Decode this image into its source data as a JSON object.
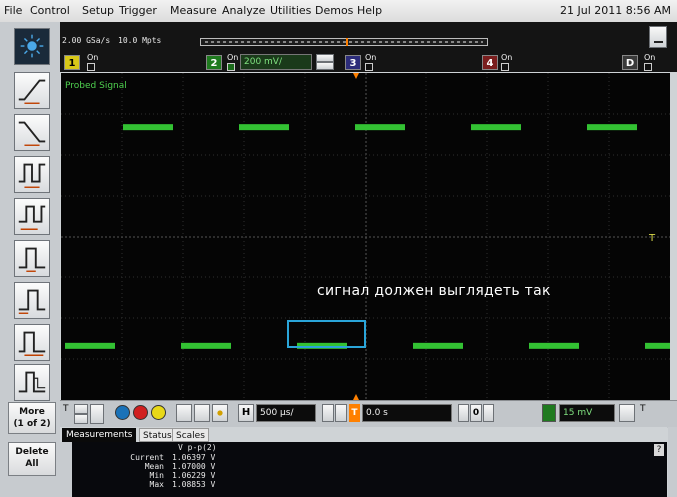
{
  "menu": {
    "items": [
      "File",
      "Control",
      "Setup",
      "Trigger",
      "Measure",
      "Analyze",
      "Utilities",
      "Demos",
      "Help"
    ],
    "datetime": "21 Jul 2011  8:56 AM"
  },
  "acquisition": {
    "sample_rate": "2.00 GSa/s",
    "memory_depth": "10.0 Mpts"
  },
  "channels": {
    "ch1": {
      "number": "1",
      "state": "On",
      "color": "#f2e21c"
    },
    "ch2": {
      "number": "2",
      "state": "On",
      "scale": "200 mV/",
      "color": "#34c132"
    },
    "ch3": {
      "number": "3",
      "state": "On",
      "color": "#6a6ad8"
    },
    "ch4": {
      "number": "4",
      "state": "On",
      "color": "#e04848"
    },
    "digital": {
      "label": "D",
      "state": "On"
    }
  },
  "sidebar": {
    "more_label_1": "More",
    "more_label_2": "(1 of 2)",
    "delete_label_1": "Delete",
    "delete_label_2": "All"
  },
  "scope": {
    "trace_label": "Probed Signal",
    "annotation": "сигнал должен выглядеть так",
    "trace_color": "#33c233",
    "highlight_color": "#2aa5d9",
    "trace_levels": {
      "low": 0.0,
      "high": 1.07,
      "unit": "V"
    }
  },
  "controls": {
    "horizontal_label": "H",
    "time_scale": "500 µs/",
    "trigger_label": "T",
    "delay": "0.0 s",
    "delay_nav": "0",
    "trigger_level": "15 mV",
    "trigger_t": "T"
  },
  "measurements": {
    "tabs": [
      "Measurements",
      "Status",
      "Scales"
    ],
    "header": "V p-p(2)",
    "rows": [
      {
        "label": "Current",
        "value": "1.06397 V"
      },
      {
        "label": "Mean",
        "value": "1.07000 V"
      },
      {
        "label": "Min",
        "value": "1.06229 V"
      },
      {
        "label": "Max",
        "value": "1.08853 V"
      }
    ],
    "help": "?"
  }
}
